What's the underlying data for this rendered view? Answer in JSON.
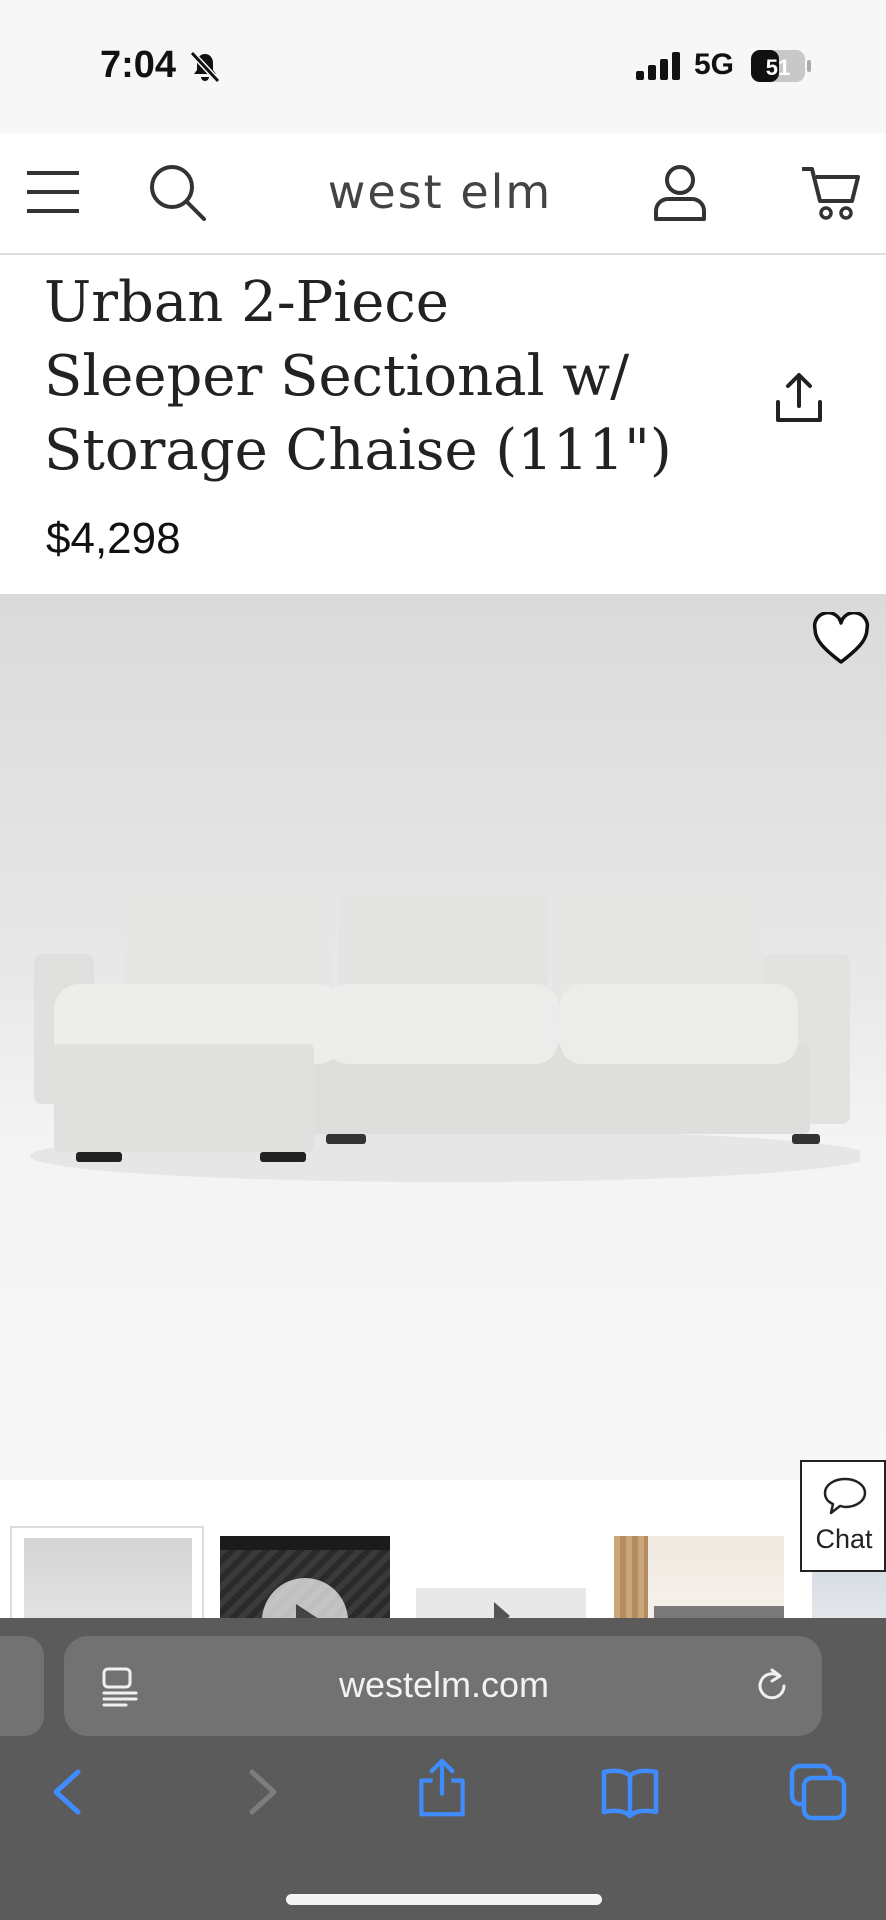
{
  "status_bar": {
    "time": "7:04",
    "network": "5G",
    "battery": "51",
    "icons": [
      "bell-slash-icon",
      "signal-icon",
      "battery-icon"
    ]
  },
  "header": {
    "brand": "west elm",
    "icons": [
      "menu-icon",
      "search-icon",
      "account-icon",
      "cart-icon"
    ]
  },
  "product": {
    "title": "Urban 2-Piece Sleeper Sectional w/ Storage Chaise (111\")",
    "price": "$4,298",
    "icons": [
      "share-icon",
      "heart-icon"
    ]
  },
  "gallery": {
    "thumbnails": [
      "thumb-1",
      "thumb-2-video",
      "thumb-3-video",
      "thumb-4",
      "thumb-5"
    ],
    "selected_index": 0
  },
  "chat": {
    "label": "Chat"
  },
  "safari": {
    "url": "westelm.com",
    "toolbar_icons": [
      "back-icon",
      "forward-icon",
      "share-icon",
      "bookmarks-icon",
      "tabs-icon"
    ],
    "accent": "#3f8cff"
  }
}
